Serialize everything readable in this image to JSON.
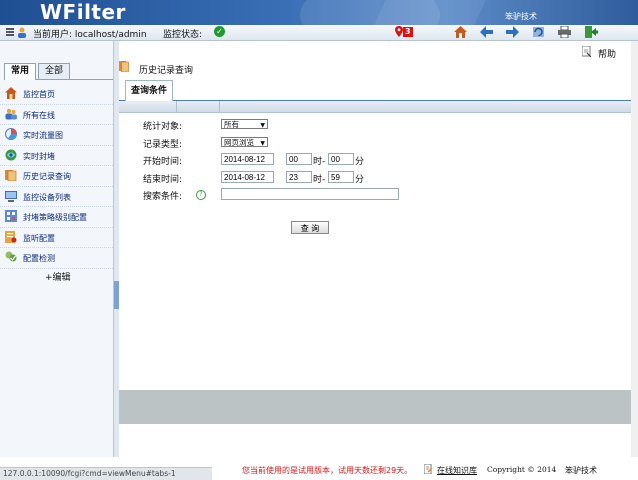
{
  "header": {
    "logo": "WFilter",
    "brand": "笨驴技术"
  },
  "statusbar": {
    "user_label": "当前用户: localhost/admin",
    "monitor_label": "监控状态:",
    "alert_count": "3"
  },
  "sidebar": {
    "tabs": [
      {
        "label": "常用"
      },
      {
        "label": "全部"
      }
    ],
    "items": [
      {
        "label": "监控首页",
        "icon": "home-icon"
      },
      {
        "label": "所有在线",
        "icon": "users-icon"
      },
      {
        "label": "实时流量图",
        "icon": "chart-icon"
      },
      {
        "label": "实时封堵",
        "icon": "block-icon"
      },
      {
        "label": "历史记录查询",
        "icon": "history-icon"
      },
      {
        "label": "监控设备列表",
        "icon": "device-icon"
      },
      {
        "label": "封堵策略级别配置",
        "icon": "policy-icon"
      },
      {
        "label": "监听配置",
        "icon": "listen-icon"
      },
      {
        "label": "配置检测",
        "icon": "check-icon"
      }
    ],
    "edit_label": "+编辑"
  },
  "main": {
    "help_label": "帮助",
    "page_title": "历史记录查询",
    "tab_label": "查询条件",
    "form": {
      "stat_label": "统计对象:",
      "stat_value": "所有",
      "type_label": "记录类型:",
      "type_value": "网页浏览",
      "start_label": "开始时间:",
      "start_date": "2014-08-12",
      "start_hour": "00",
      "start_min": "00",
      "end_label": "结束时间:",
      "end_date": "2014-08-12",
      "end_hour": "23",
      "end_min": "59",
      "hour_sep": "时-",
      "min_sep": "分",
      "search_label": "搜索条件:",
      "search_value": ""
    },
    "query_button": "查 询"
  },
  "footer": {
    "url": "127.0.0.1:10090/fcgi?cmd=viewMenu#tabs-1",
    "trial_notice": "您当前使用的是试用版本，试用天数还剩29天。",
    "kb_link": "在线知识库",
    "copyright": "Copyright © 2014",
    "company": "笨驴技术"
  },
  "colors": {
    "accent": "#1e4f92",
    "alert": "#d11111",
    "ok": "#1f9a2e"
  }
}
